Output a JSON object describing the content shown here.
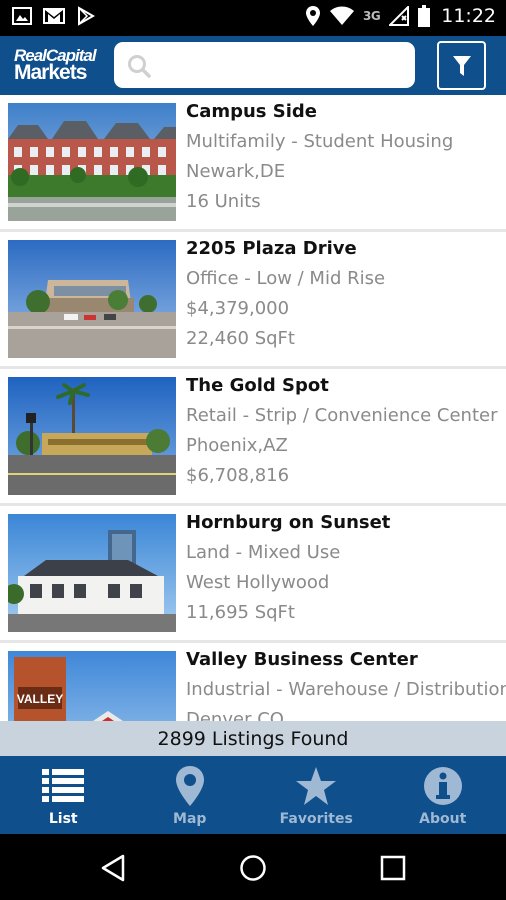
{
  "status_bar": {
    "time": "11:22",
    "network": "3G",
    "left_icons": [
      "image-icon",
      "gmail-icon",
      "play-store-icon"
    ],
    "right_icons": [
      "location-icon",
      "wifi-icon",
      "signal-icon",
      "battery-icon"
    ]
  },
  "app_bar": {
    "logo_line1": "RealCapital",
    "logo_line2": "Markets",
    "search_placeholder": "",
    "search_value": "",
    "filter_icon": "filter-icon"
  },
  "listings": [
    {
      "name": "Campus Side",
      "type": "Multifamily - Student Housing",
      "detail1": "Newark,DE",
      "detail2": "16 Units"
    },
    {
      "name": "2205 Plaza Drive",
      "type": "Office - Low / Mid Rise",
      "detail1": "$4,379,000",
      "detail2": "22,460 SqFt"
    },
    {
      "name": "The Gold Spot",
      "type": "Retail - Strip / Convenience Center",
      "detail1": "Phoenix,AZ",
      "detail2": "$6,708,816"
    },
    {
      "name": "Hornburg on Sunset",
      "type": "Land - Mixed Use",
      "detail1": "West Hollywood",
      "detail2": "11,695 SqFt"
    },
    {
      "name": "Valley Business Center",
      "type": "Industrial - Warehouse / Distribution",
      "detail1": "Denver,CO",
      "detail2": "",
      "sign_text": "VALLEY"
    }
  ],
  "listing_count": "2899 Listings Found",
  "tabs": [
    {
      "label": "List",
      "icon": "list-icon",
      "active": true
    },
    {
      "label": "Map",
      "icon": "map-pin-icon",
      "active": false
    },
    {
      "label": "Favorites",
      "icon": "star-icon",
      "active": false
    },
    {
      "label": "About",
      "icon": "info-icon",
      "active": false
    }
  ],
  "nav_bar": [
    "back-icon",
    "home-icon",
    "recents-icon"
  ],
  "colors": {
    "brand_blue": "#0e4f8c",
    "count_bar": "#c8d3de",
    "tab_inactive": "#9fb8d3"
  }
}
